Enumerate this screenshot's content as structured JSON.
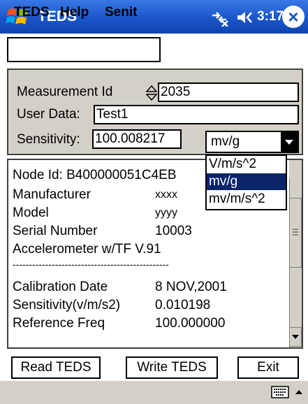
{
  "titlebar": {
    "title": "TEDS",
    "time": "3:17"
  },
  "menu": {
    "items": [
      "TEDS",
      "Help",
      "Senit"
    ]
  },
  "form": {
    "measurement_id_label": "Measurement Id",
    "measurement_id_value": "2035",
    "user_data_label": "User Data:",
    "user_data_value": "Test1",
    "sensitivity_label": "Sensitivity:",
    "sensitivity_value": "100.008217",
    "units_selected": "mv/g",
    "units_options": [
      "V/m/s^2",
      "mv/g",
      "mv/m/s^2"
    ]
  },
  "info": {
    "node_id": "Node Id: B400000051C4EB",
    "manufacturer_label": "Manufacturer",
    "manufacturer_value": "xxxx",
    "model_label": "Model",
    "model_value": "yyyy",
    "serial_label": "Serial Number",
    "serial_value": "10003",
    "description": "Accelerometer w/TF V.91",
    "separator": "------------------------------------------------",
    "cal_date_label": "Calibration Date",
    "cal_date_value": "8 NOV,2001",
    "sensitivity_label": "Sensitivity(v/m/s2)",
    "sensitivity_value": "0.010198",
    "ref_freq_label": "Reference Freq",
    "ref_freq_value": "100.000000"
  },
  "buttons": {
    "read": "Read TEDS",
    "write": "Write TEDS",
    "exit": "Exit"
  },
  "colors": {
    "titlebar": "#1a55c8",
    "selection": "#0a246a",
    "panel": "#d4d0c8"
  }
}
